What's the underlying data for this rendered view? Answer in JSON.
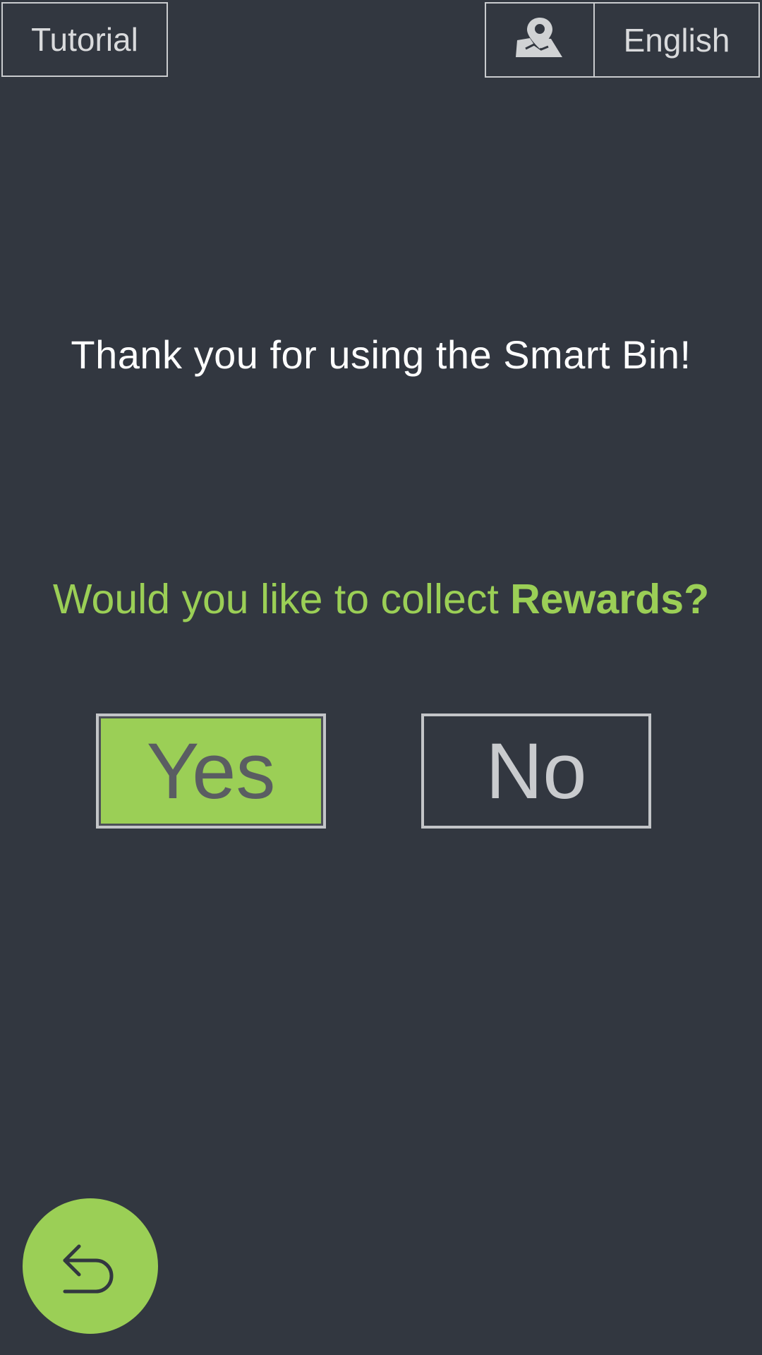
{
  "header": {
    "tutorial_label": "Tutorial",
    "location_icon": "map-pin-icon",
    "language_label": "English"
  },
  "main": {
    "thanks_text": "Thank you for using the Smart Bin!",
    "question_prefix": "Would you like to collect ",
    "question_emphasis": "Rewards?",
    "yes_label": "Yes",
    "no_label": "No"
  },
  "footer": {
    "back_icon": "return-arrow-icon"
  },
  "colors": {
    "background": "#323740",
    "accent_green": "#9bcf56",
    "border_gray": "#c9cbce",
    "text_white": "#ffffff"
  }
}
